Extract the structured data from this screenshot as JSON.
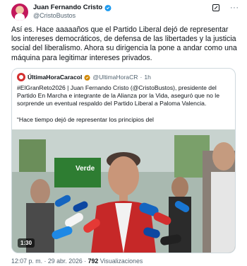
{
  "author": {
    "display_name": "Juan Fernando Cristo",
    "handle": "@CristoBustos",
    "verified_icon": "verified-badge-icon",
    "avatar_color": "#c2185b"
  },
  "actions": {
    "grok_icon": "grok-icon",
    "more_label": "···"
  },
  "tweet": {
    "text": "Así es. Hace aaaaaños que el Partido Liberal dejó de representar los intereses democráticos, de defensa de las libertades y la justicia social del liberalismo. Ahora su dirigencia la pone a andar como una máquina para legitimar intereses privados."
  },
  "quote": {
    "display_name": "ÚltimaHoraCaracol",
    "handle": "@UltimaHoraCR",
    "separator": "·",
    "time_ago": "1h",
    "paragraph_1": "#ElGranReto2026 | Juan Fernando Cristo (@CristoBustos), presidente del Partido En Marcha e integrante de la Alianza por la Vida, aseguró que no le sorprende un eventual respaldo del Partido Liberal a Paloma Valencia.",
    "paragraph_2": "“Hace tiempo dejó de representar los principios del",
    "accent_color": "#d32f2f"
  },
  "video": {
    "duration": "1:30",
    "background_sign_text": "Verde"
  },
  "meta": {
    "time": "12:07 p. m.",
    "separator": "·",
    "date": "29 abr. 2026",
    "views_count": "792",
    "views_label": "Visualizaciones"
  }
}
